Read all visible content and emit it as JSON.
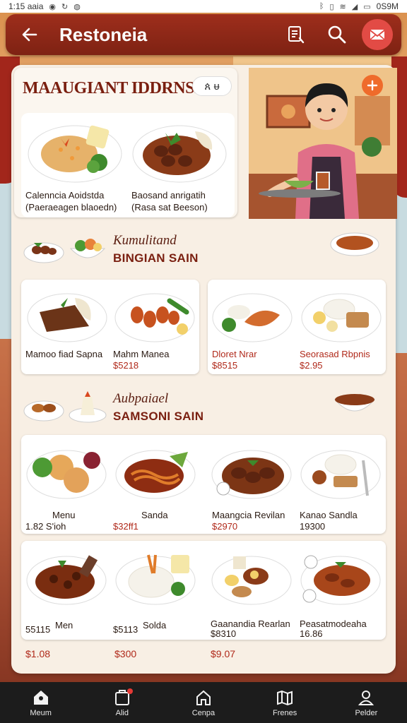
{
  "status_bar": {
    "time": "1:15 aaia",
    "right_text": "0S9M"
  },
  "app_bar": {
    "title": "Restoneia"
  },
  "hero": {
    "title": "MAAUGIANT IDDRNSIA",
    "toggle_label": "ጰ ᵾ",
    "items": [
      {
        "line1": "Calenncia Aoidstda",
        "line2": "(Paeraeagen blaoedn)"
      },
      {
        "line1": "Baosand anrigatih",
        "line2": "(Rasa sat Beeson)"
      }
    ]
  },
  "sections": [
    {
      "subtitle": "Kumulitand",
      "title": "BINGIAN SAIN"
    },
    {
      "subtitle": "Aubpaiael",
      "title": "SAMSONI SAIN"
    }
  ],
  "section1_items": [
    {
      "name": "Mamoo fiad Sapna",
      "price": ""
    },
    {
      "name": "Mahm Manea",
      "price": "$5218"
    },
    {
      "name": "Dloret Nrar",
      "price": "$8515"
    },
    {
      "name": "Seorasad Rbpnis",
      "price": "$2.95"
    }
  ],
  "section2_row1": [
    {
      "name": "Menu",
      "price": "1.82 S'ioh"
    },
    {
      "name": "Sanda",
      "price": "$32ff1"
    },
    {
      "name": "Maangcia Revilan",
      "price": "$2970"
    },
    {
      "name": "Kanao Sandla",
      "price": "19300"
    }
  ],
  "section2_row2": [
    {
      "name": "Men",
      "price": "55115"
    },
    {
      "name": "Solda",
      "price": "$5113"
    },
    {
      "name": "Gaanandia Rearlan",
      "price": "$8310"
    },
    {
      "name": "Peasatmodeaha",
      "price": "16.86"
    }
  ],
  "footer_prices": [
    "$1.08",
    "$300",
    "$9.07"
  ],
  "bottom_nav": [
    {
      "label": "Meum",
      "icon": "home-icon"
    },
    {
      "label": "Alid",
      "icon": "orders-icon"
    },
    {
      "label": "Cenpa",
      "icon": "house-icon"
    },
    {
      "label": "Frenes",
      "icon": "map-icon"
    },
    {
      "label": "Pelder",
      "icon": "profile-icon"
    }
  ],
  "colors": {
    "app_bar": "#9e2e1c",
    "accent_red": "#7a1f10",
    "cart_button": "#e24b45",
    "fab": "#ef6b2b",
    "panel": "#f8efe4",
    "nav_bg": "#1c1c1c"
  }
}
